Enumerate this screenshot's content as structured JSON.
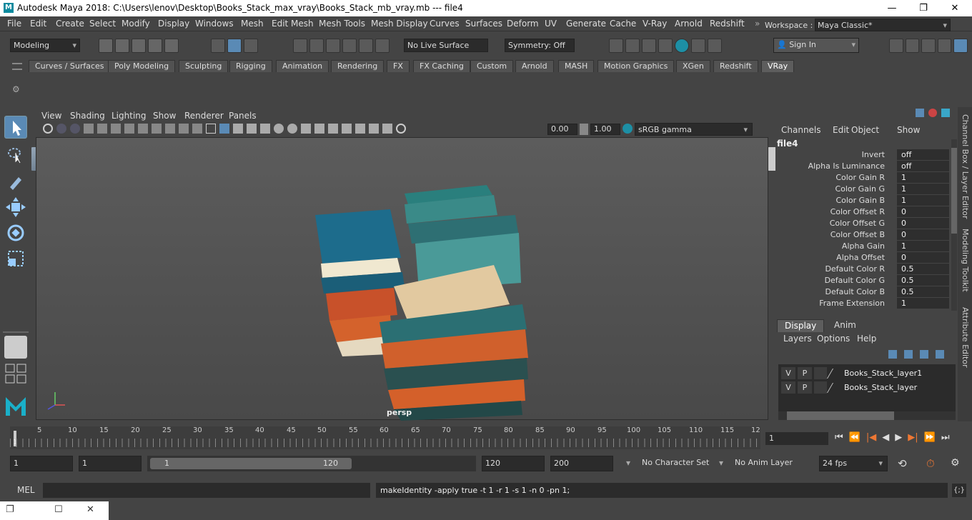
{
  "window": {
    "title": "Autodesk Maya 2018: C:\\Users\\lenov\\Desktop\\Books_Stack_max_vray\\Books_Stack_mb_vray.mb   ---   file4",
    "app_icon": "M",
    "minimize": "—",
    "maximize": "❐",
    "close": "✕"
  },
  "menubar": {
    "items": [
      "File",
      "Edit",
      "Create",
      "Select",
      "Modify",
      "Display",
      "Windows",
      "Mesh",
      "Edit Mesh",
      "Mesh Tools",
      "Mesh Display",
      "Curves",
      "Surfaces",
      "Deform",
      "UV",
      "Generate",
      "Cache",
      "V-Ray",
      "Arnold",
      "Redshift"
    ],
    "workspace_label": "Workspace :",
    "workspace_value": "Maya Classic*"
  },
  "statusline": {
    "mode": "Modeling",
    "live_surface": "No Live Surface",
    "symmetry": "Symmetry: Off",
    "sign_in": "Sign In"
  },
  "shelf": {
    "tabs": [
      "Curves / Surfaces",
      "Poly Modeling",
      "Sculpting",
      "Rigging",
      "Animation",
      "Rendering",
      "FX",
      "FX Caching",
      "Custom",
      "Arnold",
      "MASH",
      "Motion Graphics",
      "XGen",
      "Redshift",
      "VRay"
    ],
    "active_tab": "VRay"
  },
  "panel": {
    "menu": [
      "View",
      "Shading",
      "Lighting",
      "Show",
      "Renderer",
      "Panels"
    ],
    "exposure": "0.00",
    "gamma": "1.00",
    "color_space": "sRGB gamma",
    "camera_label": "persp"
  },
  "channelbox": {
    "menu": [
      "Channels",
      "Edit",
      "Object",
      "Show"
    ],
    "node_name": "file4",
    "channels": [
      {
        "label": "Invert",
        "value": "off"
      },
      {
        "label": "Alpha Is Luminance",
        "value": "off"
      },
      {
        "label": "Color Gain R",
        "value": "1"
      },
      {
        "label": "Color Gain G",
        "value": "1"
      },
      {
        "label": "Color Gain B",
        "value": "1"
      },
      {
        "label": "Color Offset R",
        "value": "0"
      },
      {
        "label": "Color Offset G",
        "value": "0"
      },
      {
        "label": "Color Offset B",
        "value": "0"
      },
      {
        "label": "Alpha Gain",
        "value": "1"
      },
      {
        "label": "Alpha Offset",
        "value": "0"
      },
      {
        "label": "Default Color R",
        "value": "0.5"
      },
      {
        "label": "Default Color G",
        "value": "0.5"
      },
      {
        "label": "Default Color B",
        "value": "0.5"
      },
      {
        "label": "Frame Extension",
        "value": "1"
      }
    ]
  },
  "layers": {
    "tabs": [
      "Display",
      "Anim"
    ],
    "menu": [
      "Layers",
      "Options",
      "Help"
    ],
    "rows": [
      {
        "v": "V",
        "p": "P",
        "name": "Books_Stack_layer1"
      },
      {
        "v": "V",
        "p": "P",
        "name": "Books_Stack_layer"
      }
    ]
  },
  "sidetabs": [
    "Channel Box / Layer Editor",
    "Modeling Toolkit",
    "Attribute Editor"
  ],
  "timeline": {
    "ticks": [
      "5",
      "10",
      "15",
      "20",
      "25",
      "30",
      "35",
      "40",
      "45",
      "50",
      "55",
      "60",
      "65",
      "70",
      "75",
      "80",
      "85",
      "90",
      "95",
      "100",
      "105",
      "110",
      "115",
      "12"
    ],
    "current_frame": "1",
    "marker": "1"
  },
  "range": {
    "start": "1",
    "playback_start": "1",
    "slider_start": "1",
    "slider_end": "120",
    "playback_end": "120",
    "end": "200",
    "character_set": "No Character Set",
    "anim_layer": "No Anim Layer",
    "fps": "24 fps"
  },
  "cmdline": {
    "lang": "MEL",
    "output": "makeIdentity -apply true -t 1 -r 1 -s 1 -n 0 -pn 1;"
  }
}
